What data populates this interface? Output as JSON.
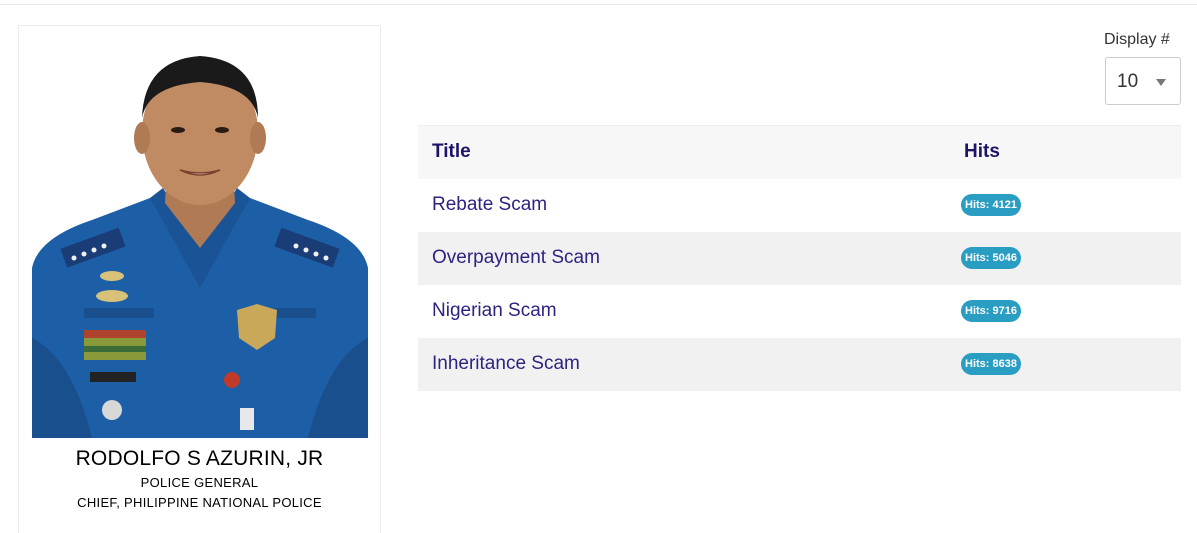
{
  "profile": {
    "name": "RODOLFO S AZURIN, JR",
    "rank": "POLICE GENERAL",
    "position": "CHIEF, PHILIPPINE NATIONAL POLICE",
    "portrait_icon": "person-portrait-icon"
  },
  "display": {
    "label": "Display #",
    "selected": "10"
  },
  "table": {
    "headers": {
      "title": "Title",
      "hits": "Hits"
    },
    "rows": [
      {
        "title": "Rebate Scam",
        "hits": "Hits: 4121"
      },
      {
        "title": "Overpayment Scam",
        "hits": "Hits: 5046"
      },
      {
        "title": "Nigerian Scam",
        "hits": "Hits: 9716"
      },
      {
        "title": "Inheritance Scam",
        "hits": "Hits: 8638"
      }
    ]
  },
  "colors": {
    "link": "#2c2480",
    "header_text": "#1c1466",
    "badge": "#2a9dc2",
    "uniform": "#1d5fa6"
  }
}
